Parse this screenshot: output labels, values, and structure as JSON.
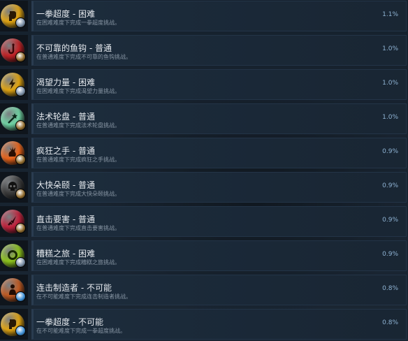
{
  "achievements": [
    {
      "title": "一拳超度 - 困难",
      "description": "在困难难度下完成一拳超度挑战。",
      "percent": "1.1%",
      "icon": "fist-icon",
      "medal_color": "#e0a413",
      "badge_color": "#7b8fa6"
    },
    {
      "title": "不可靠的鱼钩 - 普通",
      "description": "在普通难度下完成不可靠的鱼钩挑战。",
      "percent": "1.0%",
      "icon": "fishhook-icon",
      "medal_color": "#c02226",
      "badge_color": "#8f6a2c"
    },
    {
      "title": "渴望力量 - 困难",
      "description": "在困难难度下完成渴望力量挑战。",
      "percent": "1.0%",
      "icon": "lightning-icon",
      "medal_color": "#e0a413",
      "badge_color": "#7b8fa6"
    },
    {
      "title": "法术轮盘 - 普通",
      "description": "在普通难度下完成法术轮盘挑战。",
      "percent": "1.0%",
      "icon": "magic-wand-icon",
      "medal_color": "#6fd3a3",
      "badge_color": "#8f6a2c"
    },
    {
      "title": "疯狂之手 - 普通",
      "description": "在普通难度下完成疯狂之手挑战。",
      "percent": "0.9%",
      "icon": "claw-hand-icon",
      "medal_color": "#e8631a",
      "badge_color": "#8f6a2c"
    },
    {
      "title": "大快朵颐 - 普通",
      "description": "在普通难度下完成大快朵颐挑战。",
      "percent": "0.9%",
      "icon": "skull-icon",
      "medal_color": "#3c3c3c",
      "badge_color": "#8f6a2c"
    },
    {
      "title": "直击要害 - 普通",
      "description": "在普通难度下完成直击要害挑战。",
      "percent": "0.9%",
      "icon": "dagger-icon",
      "medal_color": "#c0223c",
      "badge_color": "#8f6a2c"
    },
    {
      "title": "糟糕之旅 - 困难",
      "description": "在困难难度下完成糟糕之旅挑战。",
      "percent": "0.9%",
      "icon": "ring-icon",
      "medal_color": "#8cc21c",
      "badge_color": "#7b8fa6"
    },
    {
      "title": "连击制造者 - 不可能",
      "description": "在不可能难度下完成连击制造者挑战。",
      "percent": "0.8%",
      "icon": "warrior-silhouette-icon",
      "medal_color": "#c05a22",
      "badge_color": "#3d8fd6"
    },
    {
      "title": "一拳超度 - 不可能",
      "description": "在不可能难度下完成一拳超度挑战。",
      "percent": "0.8%",
      "icon": "fist-icon",
      "medal_color": "#e0a413",
      "badge_color": "#3d8fd6"
    }
  ]
}
